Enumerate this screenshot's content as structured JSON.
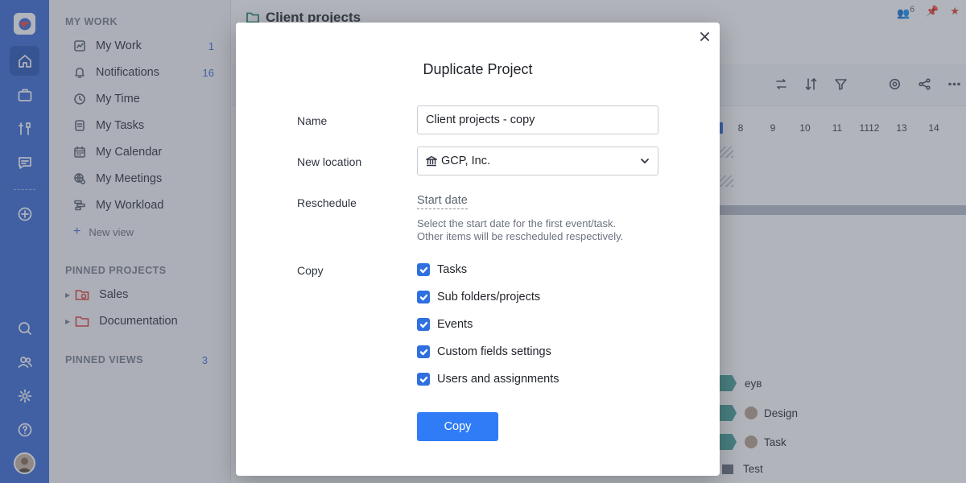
{
  "sidebar": {
    "my_work_title": "MY WORK",
    "items": [
      {
        "label": "My Work",
        "count": "1",
        "icon": "chart-check-icon"
      },
      {
        "label": "Notifications",
        "count": "16",
        "icon": "bell-icon"
      },
      {
        "label": "My Time",
        "count": "",
        "icon": "clock-icon"
      },
      {
        "label": "My Tasks",
        "count": "",
        "icon": "document-icon"
      },
      {
        "label": "My Calendar",
        "count": "",
        "icon": "calendar-icon"
      },
      {
        "label": "My Meetings",
        "count": "",
        "icon": "meeting-icon"
      },
      {
        "label": "My Workload",
        "count": "",
        "icon": "workload-icon"
      }
    ],
    "new_view": "New view",
    "pinned_projects_title": "PINNED PROJECTS",
    "pinned_projects": [
      {
        "label": "Sales",
        "icon": "sales-folder-icon"
      },
      {
        "label": "Documentation",
        "icon": "folder-icon"
      }
    ],
    "pinned_views_title": "PINNED VIEWS",
    "pinned_views_count": "3"
  },
  "main": {
    "title": "Client projects",
    "top_counter": "6",
    "days": [
      "8",
      "9",
      "10",
      "11",
      "1112",
      "13",
      "14"
    ],
    "gantt_rows": [
      "eyв",
      "Design",
      "Task",
      "Test"
    ]
  },
  "modal": {
    "title": "Duplicate Project",
    "name_label": "Name",
    "name_value": "Client projects - copy",
    "location_label": "New location",
    "location_value": "GCP, Inc.",
    "reschedule_label": "Reschedule",
    "start_date": "Start date",
    "hint_line1": "Select the start date for the first event/task.",
    "hint_line2": "Other items will be rescheduled respectively.",
    "copy_label": "Copy",
    "options": [
      {
        "label": "Tasks",
        "checked": true
      },
      {
        "label": "Sub folders/projects",
        "checked": true
      },
      {
        "label": "Events",
        "checked": true
      },
      {
        "label": "Custom fields settings",
        "checked": true
      },
      {
        "label": "Users and assignments",
        "checked": true
      }
    ],
    "copy_button": "Copy"
  },
  "colors": {
    "rail": "#3f6fd8",
    "accent": "#2f7cf6",
    "checkbox": "#2f6fe0"
  }
}
